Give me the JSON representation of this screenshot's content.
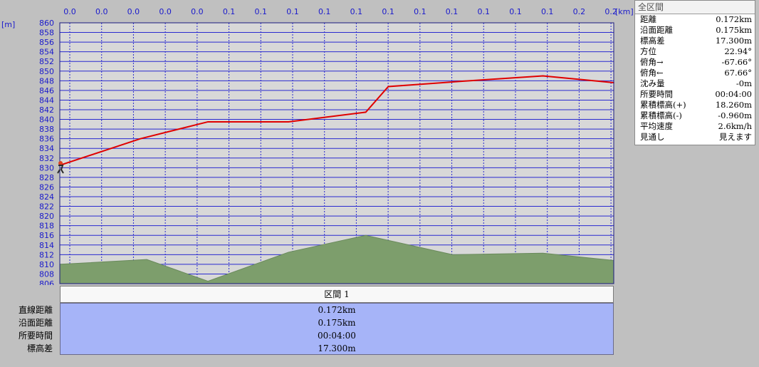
{
  "chart_data": {
    "type": "area",
    "x_unit": "[km]",
    "y_unit": "[m]",
    "x_tick_labels": [
      "0.0",
      "0.0",
      "0.0",
      "0.0",
      "0.0",
      "0.1",
      "0.1",
      "0.1",
      "0.1",
      "0.1",
      "0.1",
      "0.1",
      "0.1",
      "0.1",
      "0.1",
      "0.1",
      "0.2",
      "0.2"
    ],
    "ylim": [
      806,
      860
    ],
    "y_step": 2,
    "x_range": [
      0,
      0.172
    ],
    "grid": true,
    "series": [
      {
        "role": "route-elevation",
        "color": "#e00000",
        "points": [
          [
            0.0,
            830.5
          ],
          [
            0.025,
            836.0
          ],
          [
            0.046,
            839.5
          ],
          [
            0.071,
            839.5
          ],
          [
            0.095,
            841.5
          ],
          [
            0.102,
            846.8
          ],
          [
            0.125,
            847.9
          ],
          [
            0.15,
            849.0
          ],
          [
            0.172,
            847.6
          ]
        ]
      },
      {
        "role": "terrain",
        "color": "#7d9e6c",
        "points": [
          [
            0.0,
            810.0
          ],
          [
            0.027,
            811.0
          ],
          [
            0.046,
            806.5
          ],
          [
            0.071,
            812.5
          ],
          [
            0.095,
            816.0
          ],
          [
            0.122,
            812.0
          ],
          [
            0.15,
            812.3
          ],
          [
            0.172,
            810.8
          ]
        ]
      }
    ]
  },
  "colors": {
    "plot_bg": "#d8d8d8",
    "grid": "#2a2ad0",
    "axis_text": "#1a1acc",
    "segment_bg": "#a6b4f8"
  },
  "stats": {
    "title": "全区間",
    "rows": [
      {
        "label": "距離",
        "value": "0.172km"
      },
      {
        "label": "沿面距離",
        "value": "0.175km"
      },
      {
        "label": "標高差",
        "value": "17.300m"
      },
      {
        "label": "方位",
        "value": "22.94°"
      },
      {
        "label": "俯角→",
        "value": "-67.66°"
      },
      {
        "label": "俯角←",
        "value": "67.66°"
      },
      {
        "label": "沈み量",
        "value": "-0m"
      },
      {
        "label": "所要時間",
        "value": "00:04:00"
      },
      {
        "label": "累積標高(+)",
        "value": "18.260m"
      },
      {
        "label": "累積標高(-)",
        "value": "-0.960m"
      },
      {
        "label": "平均速度",
        "value": "2.6km/h"
      },
      {
        "label": "見通し",
        "value": "見えます"
      }
    ]
  },
  "segment": {
    "header": "区間 1",
    "labels": [
      "直線距離",
      "沿面距離",
      "所要時間",
      "標高差"
    ],
    "values": [
      "0.172km",
      "0.175km",
      "00:04:00",
      "17.300m"
    ]
  },
  "icons": {
    "start_marker": "hiker-icon"
  }
}
